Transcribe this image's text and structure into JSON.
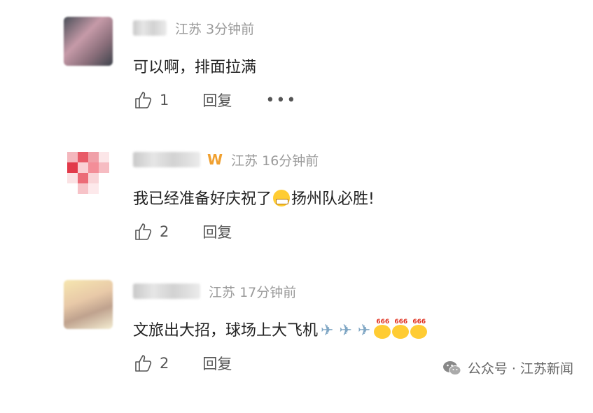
{
  "comments": [
    {
      "location": "江苏",
      "time": "3分钟前",
      "text": "可以啊，排面拉满",
      "likes": "1",
      "reply_label": "回复",
      "more_label": "•••"
    },
    {
      "location": "江苏",
      "time": "16分钟前",
      "text_before": "我已经准备好庆祝了",
      "text_after": "扬州队必胜!",
      "likes": "2",
      "reply_label": "回复"
    },
    {
      "location": "江苏",
      "time": "17分钟前",
      "text": "文旅出大招，球场上大飞机",
      "emoji_tag": "666",
      "likes": "2",
      "reply_label": "回复"
    }
  ],
  "icons": {
    "like": "thumbs-up-icon",
    "vip": "vip-badge-icon",
    "plane": "airplane-emoji",
    "grin": "grin-emoji",
    "watermark": "wechat-icon"
  },
  "watermark": {
    "text": "公众号 · 江苏新闻"
  },
  "colors": {
    "meta": "#9a9a9a",
    "text": "#222222",
    "vip": "#f0a030"
  }
}
